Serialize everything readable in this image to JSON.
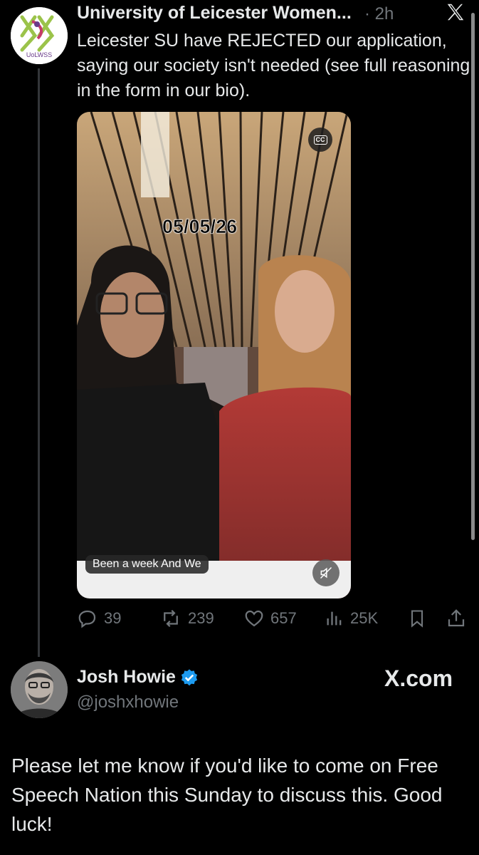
{
  "tweet": {
    "author_name": "University of Leicester Women...",
    "time": "· 2h",
    "avatar_text": "UoLWSS",
    "text": "Leicester SU have REJECTED our application, saying our society isn't needed (see full reasoning in the form in our bio).",
    "media": {
      "date_overlay": "05/05/26",
      "cc_label": "CC",
      "caption": "Been a week And We"
    },
    "stats": {
      "replies": "39",
      "reposts": "239",
      "likes": "657",
      "views": "25K"
    }
  },
  "reply_card": {
    "name": "Josh Howie",
    "handle": "@joshxhowie",
    "site_label": "X.com",
    "text": "Please let me know if you'd like to come on Free Speech Nation this Sunday to discuss this. Good luck!"
  },
  "icons": [
    "x-logo-icon",
    "cc-icon",
    "mute-icon",
    "reply-icon",
    "repost-icon",
    "like-icon",
    "views-icon",
    "bookmark-icon",
    "share-icon",
    "verified-badge-icon"
  ],
  "colors": {
    "background": "#000000",
    "text": "#e7e9ea",
    "muted": "#71767b",
    "verified": "#1d9bf0"
  }
}
